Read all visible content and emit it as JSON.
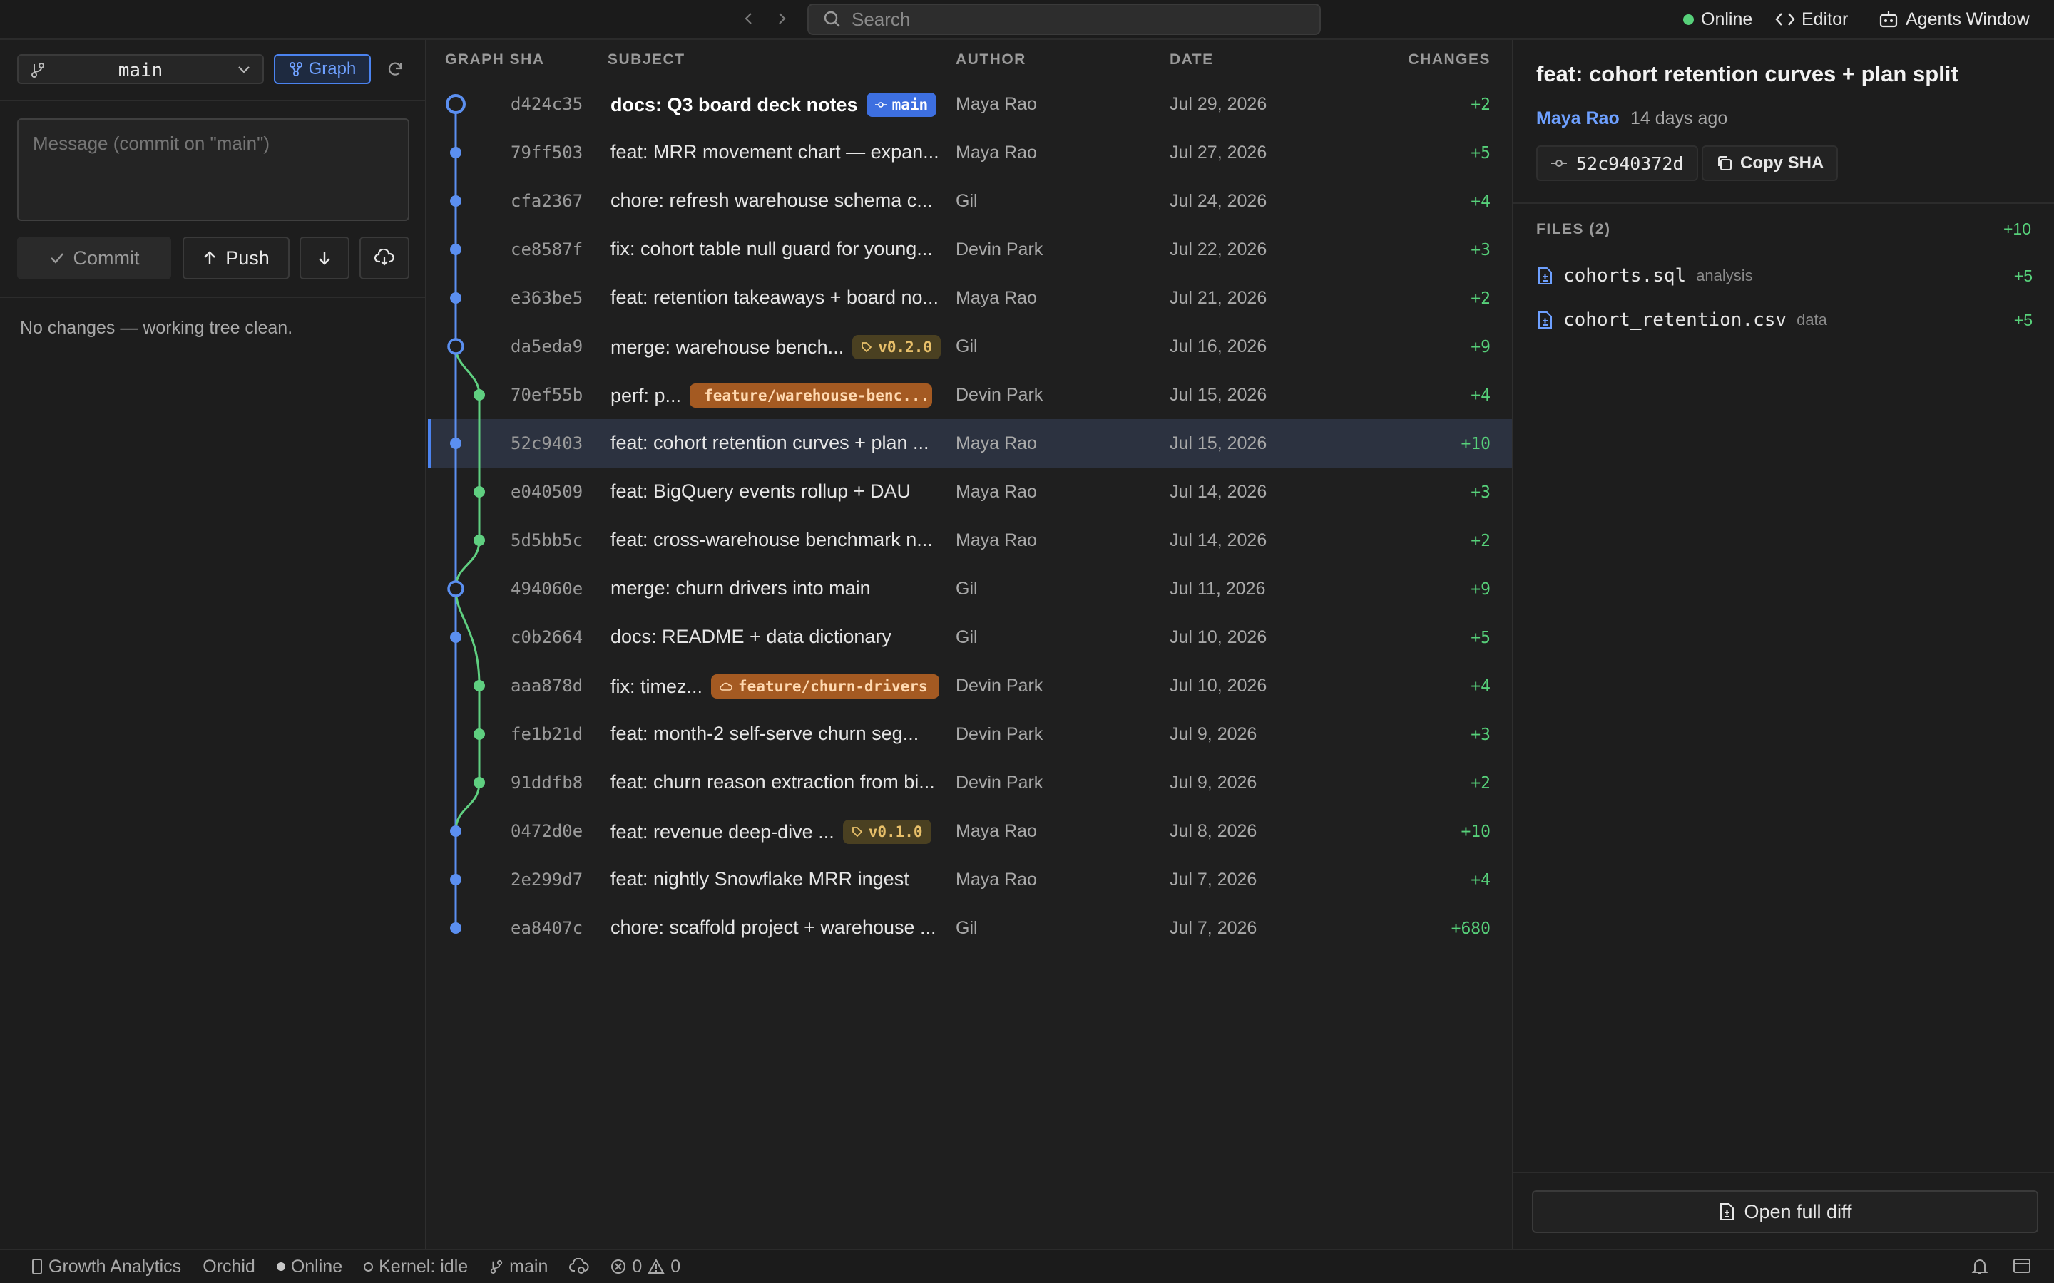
{
  "topbar": {
    "search_placeholder": "Search",
    "status_label": "Online",
    "editor_label": "Editor",
    "agents_label": "Agents Window"
  },
  "left": {
    "branch": "main",
    "graph_label": "Graph",
    "message_placeholder": "Message (commit on \"main\")",
    "commit_label": "Commit",
    "push_label": "Push",
    "clean_message": "No changes — working tree clean."
  },
  "table": {
    "headers": {
      "graph_sha": "GRAPH SHA",
      "subject": "SUBJECT",
      "author": "AUTHOR",
      "date": "DATE",
      "changes": "CHANGES"
    },
    "rows": [
      {
        "sha": "d424c35",
        "subject": "docs: Q3 board deck notes",
        "badge": "main",
        "badge_type": "main",
        "author": "Maya Rao",
        "date": "Jul 29, 2026",
        "changes": "+2"
      },
      {
        "sha": "79ff503",
        "subject": "feat: MRR movement chart — expan...",
        "author": "Maya Rao",
        "date": "Jul 27, 2026",
        "changes": "+5"
      },
      {
        "sha": "cfa2367",
        "subject": "chore: refresh warehouse schema c...",
        "author": "Gil",
        "date": "Jul 24, 2026",
        "changes": "+4"
      },
      {
        "sha": "ce8587f",
        "subject": "fix: cohort table null guard for young...",
        "author": "Devin Park",
        "date": "Jul 22, 2026",
        "changes": "+3"
      },
      {
        "sha": "e363be5",
        "subject": "feat: retention takeaways + board no...",
        "author": "Maya Rao",
        "date": "Jul 21, 2026",
        "changes": "+2"
      },
      {
        "sha": "da5eda9",
        "subject": "merge: warehouse bench...",
        "badge": "v0.2.0",
        "badge_type": "tag",
        "author": "Gil",
        "date": "Jul 16, 2026",
        "changes": "+9"
      },
      {
        "sha": "70ef55b",
        "subject": "perf: p...",
        "badge": "feature/warehouse-benc...",
        "badge_type": "feat",
        "author": "Devin Park",
        "date": "Jul 15, 2026",
        "changes": "+4"
      },
      {
        "sha": "52c9403",
        "subject": "feat: cohort retention curves + plan ...",
        "author": "Maya Rao",
        "date": "Jul 15, 2026",
        "changes": "+10",
        "selected": true
      },
      {
        "sha": "e040509",
        "subject": "feat: BigQuery events rollup + DAU",
        "author": "Maya Rao",
        "date": "Jul 14, 2026",
        "changes": "+3"
      },
      {
        "sha": "5d5bb5c",
        "subject": "feat: cross-warehouse benchmark n...",
        "author": "Maya Rao",
        "date": "Jul 14, 2026",
        "changes": "+2"
      },
      {
        "sha": "494060e",
        "subject": "merge: churn drivers into main",
        "author": "Gil",
        "date": "Jul 11, 2026",
        "changes": "+9"
      },
      {
        "sha": "c0b2664",
        "subject": "docs: README + data dictionary",
        "author": "Gil",
        "date": "Jul 10, 2026",
        "changes": "+5"
      },
      {
        "sha": "aaa878d",
        "subject": "fix: timez...",
        "badge": "feature/churn-drivers",
        "badge_type": "feat",
        "author": "Devin Park",
        "date": "Jul 10, 2026",
        "changes": "+4"
      },
      {
        "sha": "fe1b21d",
        "subject": "feat: month-2 self-serve churn seg...",
        "author": "Devin Park",
        "date": "Jul 9, 2026",
        "changes": "+3"
      },
      {
        "sha": "91ddfb8",
        "subject": "feat: churn reason extraction from bi...",
        "author": "Devin Park",
        "date": "Jul 9, 2026",
        "changes": "+2"
      },
      {
        "sha": "0472d0e",
        "subject": "feat: revenue deep-dive ...",
        "badge": "v0.1.0",
        "badge_type": "tag",
        "author": "Maya Rao",
        "date": "Jul 8, 2026",
        "changes": "+10"
      },
      {
        "sha": "2e299d7",
        "subject": "feat: nightly Snowflake MRR ingest",
        "author": "Maya Rao",
        "date": "Jul 7, 2026",
        "changes": "+4"
      },
      {
        "sha": "ea8407c",
        "subject": "chore: scaffold project + warehouse ...",
        "author": "Gil",
        "date": "Jul 7, 2026",
        "changes": "+680"
      }
    ]
  },
  "details": {
    "title": "feat: cohort retention curves + plan split",
    "author": "Maya Rao",
    "when": "14 days ago",
    "sha": "52c940372d",
    "copy_label": "Copy SHA",
    "files_header": "FILES (2)",
    "files_total": "+10",
    "files": [
      {
        "name": "cohorts.sql",
        "dir": "analysis",
        "changes": "+5"
      },
      {
        "name": "cohort_retention.csv",
        "dir": "data",
        "changes": "+5"
      }
    ],
    "open_diff_label": "Open full diff"
  },
  "statusbar": {
    "project": "Growth Analytics",
    "app": "Orchid",
    "connection": "Online",
    "kernel": "Kernel: idle",
    "branch": "main",
    "errors": "0",
    "warnings": "0"
  },
  "colors": {
    "accent": "#4b83f0",
    "main_lane": "#5b8ff0",
    "feature_lane": "#5fcf80",
    "added": "#57d17a"
  }
}
